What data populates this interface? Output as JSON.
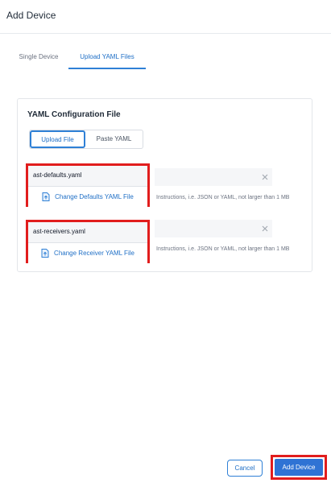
{
  "header": {
    "title": "Add Device"
  },
  "tabs": [
    {
      "label": "Single Device",
      "active": false
    },
    {
      "label": "Upload YAML Files",
      "active": true
    }
  ],
  "card": {
    "title": "YAML Configuration File",
    "mode_options": [
      {
        "label": "Upload File",
        "selected": true
      },
      {
        "label": "Paste YAML",
        "selected": false
      }
    ],
    "files": [
      {
        "name": "ast-defaults.yaml",
        "change_label": "Change Defaults YAML File",
        "hint": "Instructions, i.e. JSON or YAML, not larger than 1 MB"
      },
      {
        "name": "ast-receivers.yaml",
        "change_label": "Change Receiver YAML File",
        "hint": "Instructions, i.e. JSON or YAML, not larger than 1 MB"
      }
    ]
  },
  "footer": {
    "cancel_label": "Cancel",
    "submit_label": "Add Device"
  },
  "colors": {
    "accent": "#2f80d6",
    "highlight": "#e11d1d"
  }
}
